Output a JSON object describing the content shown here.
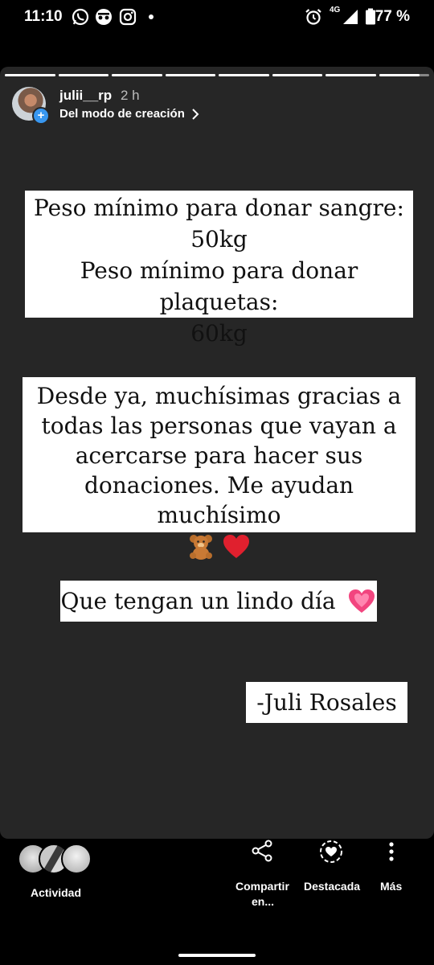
{
  "status_bar": {
    "time": "11:10",
    "left_icons": [
      "whatsapp-icon",
      "incognito-icon",
      "instagram-icon",
      "dot-icon"
    ],
    "right_icons": [
      "alarm-icon",
      "signal-4g-icon",
      "battery-icon"
    ],
    "network_label": "4G",
    "battery": "77 %"
  },
  "story": {
    "background_color": "#262626",
    "progress": {
      "segments": 8,
      "completed": 7,
      "current_fraction": 0.8
    },
    "username": "julii__rp",
    "time_ago": "2 h",
    "source_label": "Del modo de creación",
    "captions": [
      {
        "lines": [
          "Peso mínimo para donar sangre:",
          "50kg",
          "Peso mínimo para donar plaquetas:",
          "60kg"
        ]
      },
      {
        "lines": [
          "Desde ya, muchísimas gracias a",
          "todas las personas que vayan a",
          "acercarse para hacer sus",
          "donaciones. Me ayudan muchísimo"
        ],
        "emojis": [
          "teddy-bear-emoji",
          "red-heart-emoji"
        ]
      },
      {
        "text": "Que tengan un lindo día",
        "emoji": "pink-heart-emoji"
      },
      {
        "text": "-Juli Rosales"
      }
    ]
  },
  "bottom_bar": {
    "activity_label": "Actividad",
    "share_label_1": "Compartir",
    "share_label_2": "en...",
    "highlight_label": "Destacada",
    "more_label": "Más",
    "icons": [
      "share-icon",
      "highlight-icon",
      "more-vertical-icon"
    ]
  }
}
